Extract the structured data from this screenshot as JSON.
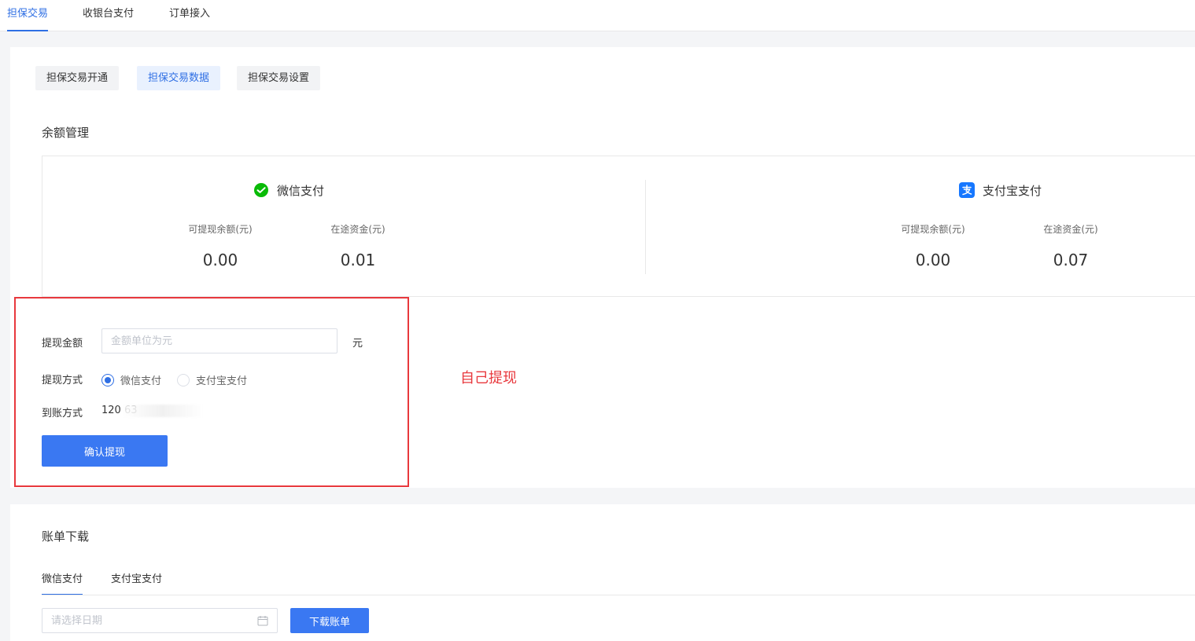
{
  "top_tabs": [
    {
      "label": "担保交易",
      "active": true
    },
    {
      "label": "收银台支付",
      "active": false
    },
    {
      "label": "订单接入",
      "active": false
    }
  ],
  "sub_tabs": [
    {
      "label": "担保交易开通",
      "active": false
    },
    {
      "label": "担保交易数据",
      "active": true
    },
    {
      "label": "担保交易设置",
      "active": false
    }
  ],
  "balance": {
    "title": "余额管理",
    "wechat": {
      "name": "微信支付",
      "icon": "wechat-pay-icon",
      "withdrawable_label": "可提现余额(元)",
      "withdrawable_value": "0.00",
      "in_transit_label": "在途资金(元)",
      "in_transit_value": "0.01"
    },
    "alipay": {
      "name": "支付宝支付",
      "icon": "alipay-icon",
      "withdrawable_label": "可提现余额(元)",
      "withdrawable_value": "0.00",
      "in_transit_label": "在途资金(元)",
      "in_transit_value": "0.07"
    }
  },
  "withdraw": {
    "amount_label": "提现金额",
    "amount_value": "",
    "amount_placeholder": "金额单位为元",
    "unit": "元",
    "method_label": "提现方式",
    "methods": [
      {
        "label": "微信支付",
        "checked": true
      },
      {
        "label": "支付宝支付",
        "checked": false
      }
    ],
    "account_label": "到账方式",
    "account_value": "120                    63",
    "confirm_label": "确认提现"
  },
  "annotation": "自己提现",
  "bill": {
    "title": "账单下载",
    "tabs": [
      {
        "label": "微信支付",
        "active": true
      },
      {
        "label": "支付宝支付",
        "active": false
      }
    ],
    "date_placeholder": "请选择日期",
    "download_label": "下载账单"
  },
  "colors": {
    "primary": "#2f6fe4",
    "button": "#3a78f2",
    "annotation_red": "#e8383d",
    "wechat_green": "#09bb07",
    "alipay_blue": "#1677ff"
  }
}
